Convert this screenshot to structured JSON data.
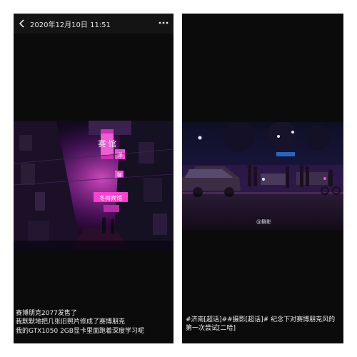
{
  "left_post": {
    "title": "2020年12月10日 11:51",
    "photo_signs": {
      "main": "赛 馆",
      "side_a": "洋",
      "side_b": "咖",
      "lower": "冬梅宾馆"
    },
    "caption_lines": [
      "赛博朋克2077发售了",
      "我默默地把几张旧照片修成了赛博朋克",
      "我的GTX1050 2GB显卡里面跑着深度学习呢"
    ]
  },
  "right_post": {
    "watermark": "@舞影",
    "caption_lines": [
      "#济南[超话]##摄影[超话]# 纪念下对赛博朋克风的",
      "第一次尝试[二哈]"
    ]
  },
  "icons": {
    "back": "chevron-left-icon",
    "more": "more-dots-icon"
  },
  "colors": {
    "panel_bg": "#0b0b0b",
    "neon_pink": "#ff3fd0",
    "neon_purple": "#7a1aa0",
    "text": "#eeeeee"
  }
}
